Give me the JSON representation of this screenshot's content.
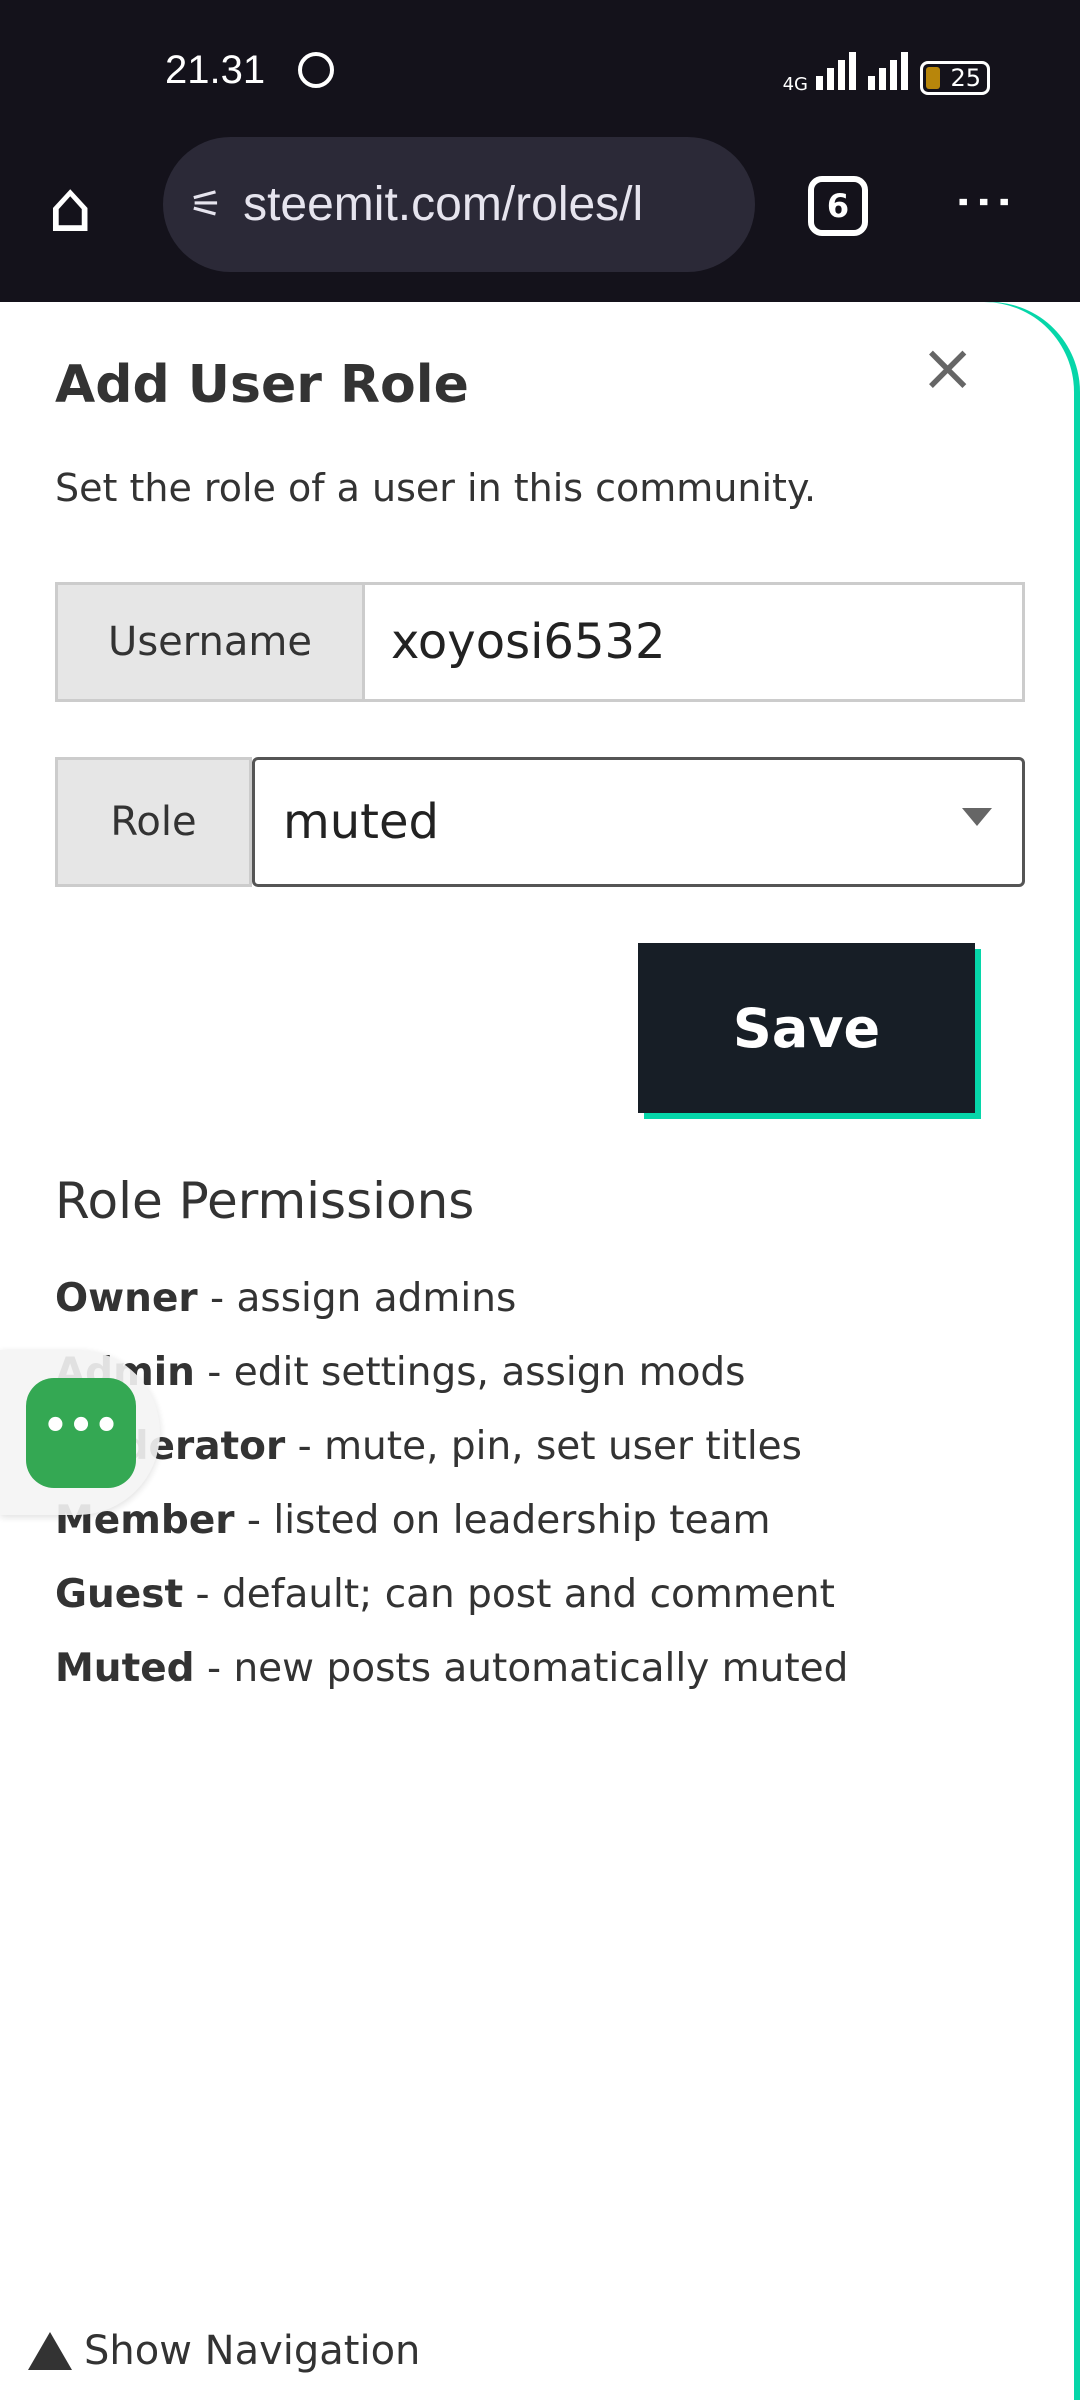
{
  "status_bar": {
    "time": "21.31",
    "network": "4G",
    "battery": "25"
  },
  "browser": {
    "url": "steemit.com/roles/l",
    "tab_count": "6"
  },
  "modal": {
    "title": "Add User Role",
    "subtitle": "Set the role of a user in this community.",
    "username_label": "Username",
    "username_value": "xoyosi6532",
    "role_label": "Role",
    "role_value": "muted",
    "save_label": "Save",
    "permissions_title": "Role Permissions",
    "permissions": [
      {
        "role": "Owner",
        "desc": " - assign admins"
      },
      {
        "role": "Admin",
        "desc": " - edit settings, assign mods"
      },
      {
        "role": "Moderator",
        "desc": " - mute, pin, set user titles"
      },
      {
        "role": "Member",
        "desc": " - listed on leadership team"
      },
      {
        "role": "Guest",
        "desc": " - default; can post and comment"
      },
      {
        "role": "Muted",
        "desc": " - new posts automatically muted"
      }
    ]
  },
  "footer": {
    "show_navigation": "Show Navigation"
  },
  "colors": {
    "accent": "#06d6a9",
    "save_bg": "#171e26",
    "fab": "#34a853"
  }
}
